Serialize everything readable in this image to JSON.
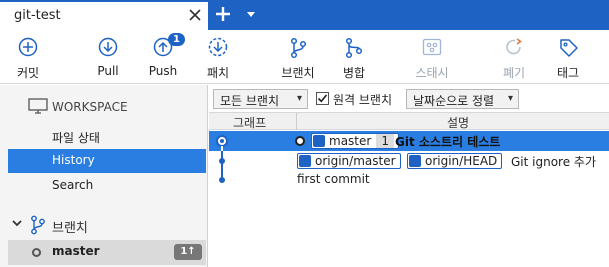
{
  "tab": {
    "title": "git-test"
  },
  "toolbar": {
    "commit": "커밋",
    "pull": "Pull",
    "push": "Push",
    "push_badge": "1",
    "fetch": "패치",
    "branch": "브랜치",
    "merge": "병합",
    "stash": "스태시",
    "discard": "폐기",
    "tag": "태그"
  },
  "sidebar": {
    "workspace": "WORKSPACE",
    "items": [
      {
        "label": "파일 상태"
      },
      {
        "label": "History"
      },
      {
        "label": "Search"
      }
    ],
    "branches_label": "브랜치",
    "current_branch": "master",
    "current_branch_badge": "1↑"
  },
  "filters": {
    "branch_filter": "모든 브랜치",
    "remote_label": "원격 브랜치",
    "remote_checked": true,
    "sort": "날짜순으로 정렬"
  },
  "columns": {
    "graph": "그래프",
    "description": "설명"
  },
  "commits": [
    {
      "refs": [
        {
          "name": "master",
          "count": "1"
        }
      ],
      "message": "Git 소스트리 테스트",
      "head": true
    },
    {
      "refs": [
        {
          "name": "origin/master"
        },
        {
          "name": "origin/HEAD"
        }
      ],
      "message": "Git ignore 추가"
    },
    {
      "refs": [],
      "message": "first commit"
    }
  ],
  "colors": {
    "accent": "#1e63c4",
    "selection": "#2a7de1",
    "disabled": "#9aa3ad"
  }
}
